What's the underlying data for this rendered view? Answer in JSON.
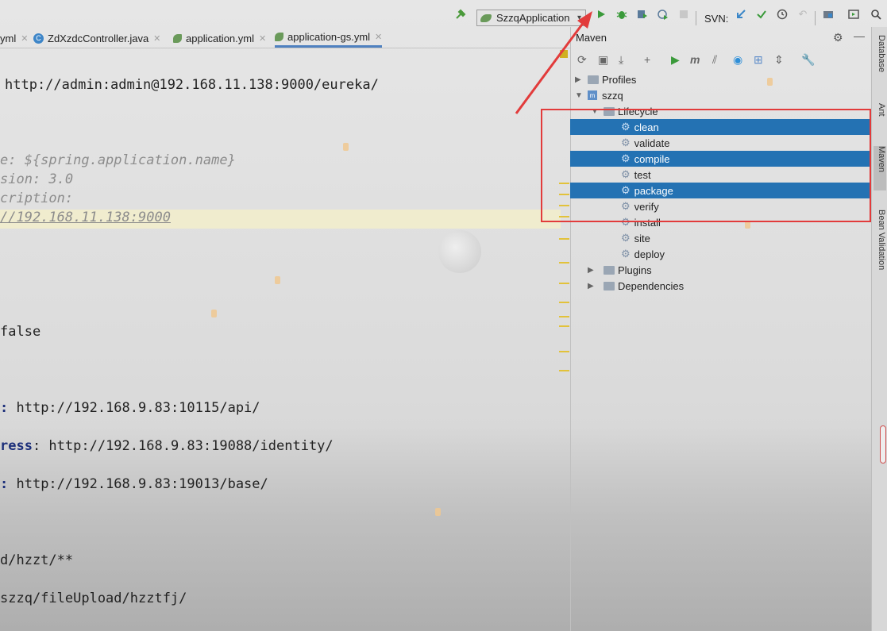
{
  "toolbar": {
    "run_config": "SzzqApplication",
    "svn_label": "SVN:"
  },
  "tabs": [
    {
      "label": "yml",
      "active": false
    },
    {
      "label": "ZdXzdcController.java",
      "active": false
    },
    {
      "label": "application.yml",
      "active": false
    },
    {
      "label": "application-gs.yml",
      "active": true
    }
  ],
  "editor": {
    "lines": {
      "l1": "http://admin:admin@192.168.11.138:9000/eureka/",
      "l2": "e: ${spring.application.name}",
      "l3": "sion: 3.0",
      "l4": "cription:",
      "l5": "//192.168.11.138:9000",
      "l6": "false",
      "l7a": ":",
      "l7b": " http://192.168.9.83:10115/api/",
      "l8a": "ress",
      "l8b": ": http://192.168.9.83:19088/identity/",
      "l9a": ":",
      "l9b": " http://192.168.9.83:19013/base/",
      "l10": "d/hzzt/**",
      "l11": "szzq/fileUpload/hzztfj/"
    }
  },
  "maven": {
    "title": "Maven",
    "tree": {
      "profiles": "Profiles",
      "project": "szzq",
      "lifecycle": "Lifecycle",
      "phases": [
        "clean",
        "validate",
        "compile",
        "test",
        "package",
        "verify",
        "install",
        "site",
        "deploy"
      ],
      "selected_phases": [
        "clean",
        "compile",
        "package"
      ],
      "plugins": "Plugins",
      "dependencies": "Dependencies"
    }
  },
  "side_tabs": [
    "Database",
    "Ant",
    "Maven",
    "Bean Validation"
  ],
  "colors": {
    "selection": "#2472b3",
    "annotation_red": "#e23b3b"
  }
}
